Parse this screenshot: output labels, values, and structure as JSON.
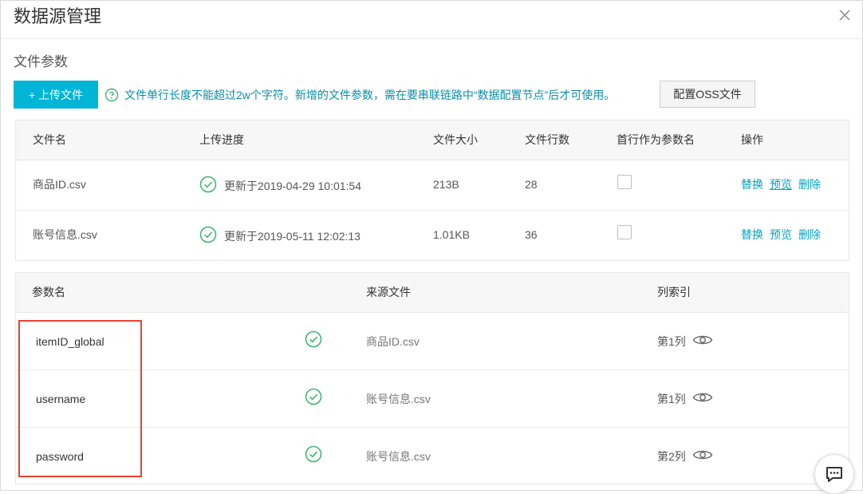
{
  "dialog": {
    "title": "数据源管理",
    "close_icon": "close-icon"
  },
  "files_section": {
    "title": "文件参数",
    "upload_label": "+ 上传文件",
    "tip": "文件单行长度不能超过2w个字符。新增的文件参数，需在要串联链路中“数据配置节点”后才可使用。",
    "oss_label": "配置OSS文件",
    "columns": [
      "文件名",
      "上传进度",
      "文件大小",
      "文件行数",
      "首行作为参数名",
      "操作"
    ],
    "rows": [
      {
        "name": "商品ID.csv",
        "progress": "更新于2019-04-29 10:01:54",
        "size": "213B",
        "lines": "28",
        "first_row_header": false,
        "actions": [
          "替换",
          "预览",
          "删除"
        ]
      },
      {
        "name": "账号信息.csv",
        "progress": "更新于2019-05-11 12:02:13",
        "size": "1.01KB",
        "lines": "36",
        "first_row_header": false,
        "actions": [
          "替换",
          "预览",
          "删除"
        ]
      }
    ]
  },
  "params_section": {
    "columns": [
      "参数名",
      "来源文件",
      "列索引"
    ],
    "rows": [
      {
        "name": "itemID_global",
        "source": "商品ID.csv",
        "column_index": "第1列"
      },
      {
        "name": "username",
        "source": "账号信息.csv",
        "column_index": "第1列"
      },
      {
        "name": "password",
        "source": "账号信息.csv",
        "column_index": "第2列"
      }
    ]
  },
  "colors": {
    "primary": "#00b5d6",
    "link": "#00a3c4",
    "success": "#3cb371",
    "highlight": "#e8432e"
  }
}
